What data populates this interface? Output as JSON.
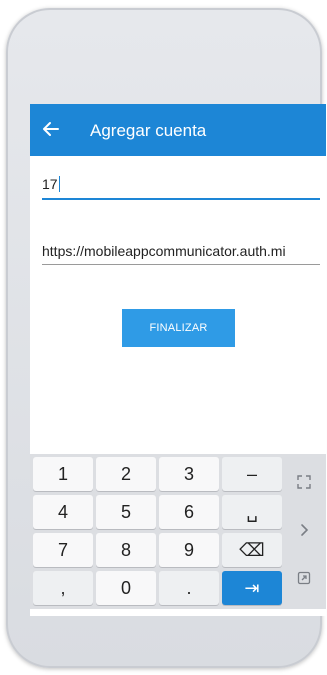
{
  "appbar": {
    "title": "Agregar cuenta",
    "back_icon": "arrow-left-icon"
  },
  "form": {
    "field1_value": "17",
    "field2_value": "https://mobileappcommunicator.auth.mi",
    "submit_label": "FINALIZAR"
  },
  "keyboard": {
    "keys": [
      "1",
      "2",
      "3",
      "–",
      "4",
      "5",
      "6",
      "␣",
      "7",
      "8",
      "9",
      "⌫",
      ",",
      "0",
      ".",
      "⇥"
    ],
    "side_icons": [
      "expand-icon",
      "chevron-right-icon",
      "clipboard-icon"
    ]
  },
  "colors": {
    "accent": "#1d86d6",
    "button": "#2f9be6",
    "keyboard_bg": "#dcdee2"
  }
}
